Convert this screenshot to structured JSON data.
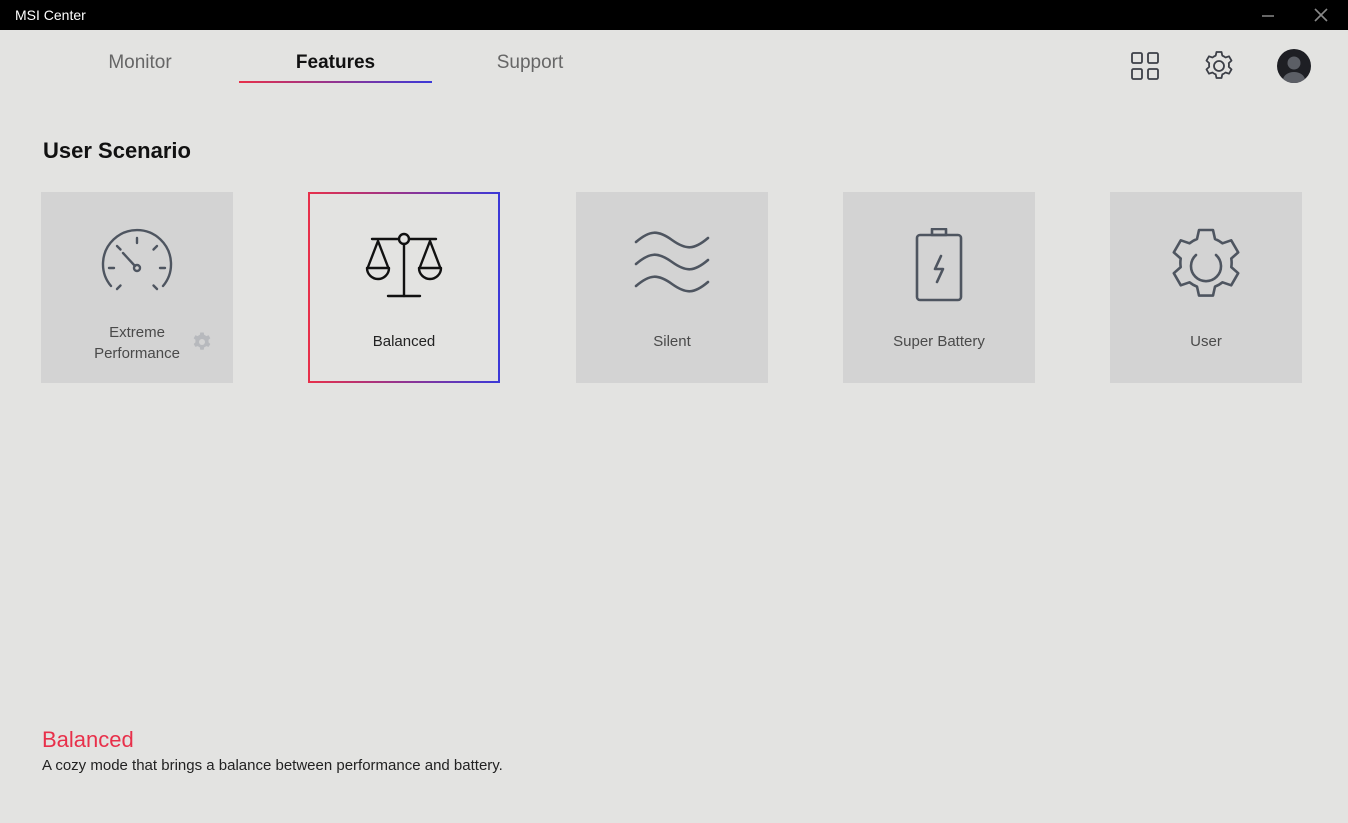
{
  "window": {
    "title": "MSI Center",
    "minimize_icon": "minimize-icon",
    "close_icon": "close-icon"
  },
  "tabs": [
    {
      "label": "Monitor",
      "active": false
    },
    {
      "label": "Features",
      "active": true
    },
    {
      "label": "Support",
      "active": false
    }
  ],
  "header_icons": [
    "grid-icon",
    "gear-icon",
    "user-avatar-icon"
  ],
  "colors": {
    "accent_red": "#e8304a",
    "accent_blue": "#3b39d8",
    "background": "#e3e3e1",
    "card": "#d3d3d3"
  },
  "section": {
    "title": "User Scenario"
  },
  "scenarios": [
    {
      "label_line1": "Extreme",
      "label_line2": "Performance",
      "icon": "speedometer-icon",
      "selected": false,
      "has_settings": true
    },
    {
      "label": "Balanced",
      "icon": "scale-icon",
      "selected": true
    },
    {
      "label": "Silent",
      "icon": "waves-icon",
      "selected": false
    },
    {
      "label": "Super Battery",
      "icon": "battery-icon",
      "selected": false
    },
    {
      "label": "User",
      "icon": "gear-icon",
      "selected": false
    }
  ],
  "selected_mode": {
    "name": "Balanced",
    "description": "A cozy mode that brings a balance between performance and battery."
  }
}
